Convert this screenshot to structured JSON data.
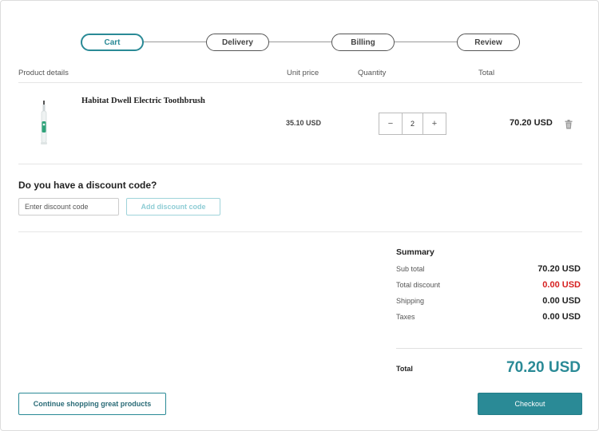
{
  "steps": [
    {
      "label": "Cart",
      "active": true
    },
    {
      "label": "Delivery",
      "active": false
    },
    {
      "label": "Billing",
      "active": false
    },
    {
      "label": "Review",
      "active": false
    }
  ],
  "columns": {
    "product": "Product details",
    "unit_price": "Unit price",
    "quantity": "Quantity",
    "total": "Total"
  },
  "cart_item": {
    "name": "Habitat Dwell Electric Toothbrush",
    "image_icon": "toothbrush-image",
    "unit_price": "35.10 USD",
    "quantity": "2",
    "decrement_label": "−",
    "increment_label": "+",
    "total": "70.20 USD",
    "remove_icon": "trash-icon"
  },
  "discount": {
    "heading": "Do you have a discount code?",
    "placeholder": "Enter discount code",
    "button_label": "Add discount code"
  },
  "summary": {
    "title": "Summary",
    "rows": [
      {
        "label": "Sub total",
        "value": "70.20 USD"
      },
      {
        "label": "Total discount",
        "value": "0.00 USD"
      },
      {
        "label": "Shipping",
        "value": "0.00 USD"
      },
      {
        "label": "Taxes",
        "value": "0.00 USD"
      }
    ],
    "total_label": "Total",
    "total_value": "70.20 USD"
  },
  "actions": {
    "continue_label": "Continue shopping great products",
    "checkout_label": "Checkout"
  },
  "colors": {
    "accent": "#2a8a96",
    "discount_red": "#d62020"
  }
}
